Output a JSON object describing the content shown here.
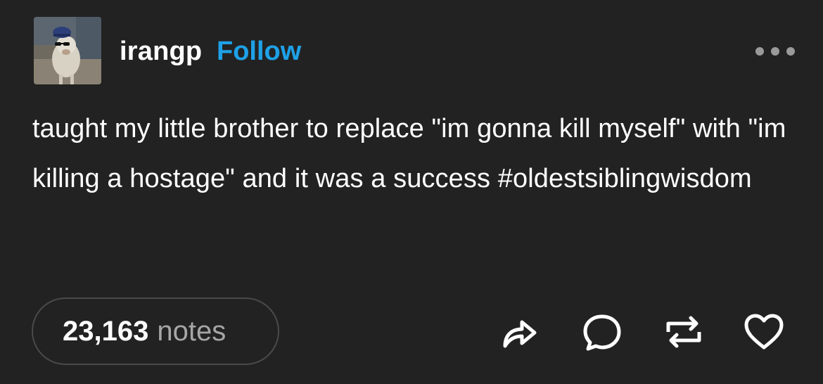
{
  "post": {
    "author": "irangp",
    "follow_label": "Follow",
    "text": "taught my little brother to replace \"im gonna kill myself\" with \"im killing a hostage\" and it was a success #oldestsiblingwisdom"
  },
  "notes": {
    "count": "23,163",
    "label": "notes"
  },
  "icons": {
    "more": "more-options-icon",
    "share": "share-icon",
    "reply": "reply-icon",
    "reblog": "reblog-icon",
    "like": "heart-icon"
  },
  "colors": {
    "background": "#222222",
    "accent": "#1ea1e7",
    "text": "#ffffff",
    "muted": "#a6a6a6"
  }
}
